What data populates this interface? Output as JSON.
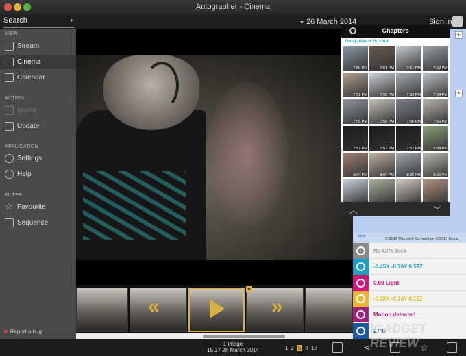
{
  "window": {
    "title": "Autographer - Cinema"
  },
  "topbar": {
    "search_label": "Search",
    "date": "26 March 2014",
    "signin": "Sign in"
  },
  "sidebar": {
    "sections": {
      "view": "VIEW",
      "action": "ACTION",
      "application": "APPLICATION",
      "filter": "FILTER"
    },
    "items": [
      {
        "label": "Stream",
        "icon": "grid-icon"
      },
      {
        "label": "Cinema",
        "icon": "cinema-icon"
      },
      {
        "label": "Calendar",
        "icon": "calendar-icon"
      },
      {
        "label": "Import",
        "icon": "import-icon"
      },
      {
        "label": "Update",
        "icon": "update-icon"
      },
      {
        "label": "Settings",
        "icon": "gear-icon"
      },
      {
        "label": "Help",
        "icon": "help-icon"
      },
      {
        "label": "Favourite",
        "icon": "star-icon"
      },
      {
        "label": "Sequence",
        "icon": "sequence-icon"
      }
    ],
    "report_bug": "Report a bug"
  },
  "chapters": {
    "title": "Chapters",
    "date": "Friday, March 28, 2014",
    "thumbs": [
      {
        "time": "7:50 PM"
      },
      {
        "time": "7:51 PM"
      },
      {
        "time": "7:51 PM"
      },
      {
        "time": "7:52 PM"
      },
      {
        "time": "7:52 PM"
      },
      {
        "time": "7:53 PM"
      },
      {
        "time": "7:53 PM"
      },
      {
        "time": "7:54 PM"
      },
      {
        "time": "7:55 PM"
      },
      {
        "time": "7:55 PM"
      },
      {
        "time": "7:56 PM"
      },
      {
        "time": "7:56 PM"
      },
      {
        "time": "7:57 PM"
      },
      {
        "time": "7:57 PM"
      },
      {
        "time": "7:57 PM"
      },
      {
        "time": "8:04 PM"
      },
      {
        "time": "8:04 PM"
      },
      {
        "time": "8:04 PM"
      },
      {
        "time": "8:05 PM"
      },
      {
        "time": "8:06 PM"
      },
      {
        "time": ""
      },
      {
        "time": ""
      },
      {
        "time": ""
      },
      {
        "time": ""
      }
    ]
  },
  "map": {
    "brand": "bing",
    "copyright": "© 2014 Microsoft Corporation © 2013 Nokia"
  },
  "sensors": [
    {
      "label": "No GPS lock",
      "color": "#8a8a8a",
      "text_color": "#9a9a9a"
    },
    {
      "label": "-0.45X  -0.70Y  0.59Z",
      "color": "#1aa0c8",
      "text_color": "#1aa0c8"
    },
    {
      "label": "0.00 Light",
      "color": "#d0147a",
      "text_color": "#d0147a"
    },
    {
      "label": "-0.18X  -0.14Y  0.11Z",
      "color": "#e8b830",
      "text_color": "#e8b830"
    },
    {
      "label": "Motion detected",
      "color": "#a0207a",
      "text_color": "#a0207a"
    },
    {
      "label": "27°C",
      "color": "#1a5aa0",
      "text_color": "#1a5aa0"
    }
  ],
  "bottom": {
    "count_line1": "1 image",
    "count_line2": "15:27 26 March 2014",
    "zoom_levels": [
      "1",
      "2",
      "5",
      "8",
      "12"
    ],
    "zoom_selected": "5"
  },
  "watermark": "IGADGET REVIEW"
}
